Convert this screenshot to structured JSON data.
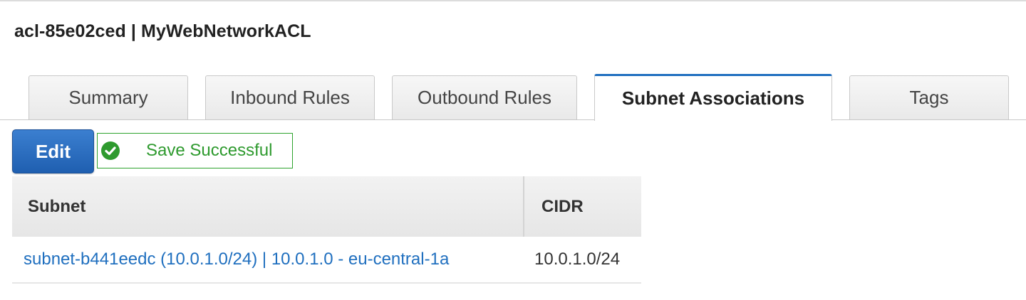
{
  "header": {
    "title": "acl-85e02ced | MyWebNetworkACL"
  },
  "tabs": [
    {
      "label": "Summary",
      "active": false
    },
    {
      "label": "Inbound Rules",
      "active": false
    },
    {
      "label": "Outbound Rules",
      "active": false
    },
    {
      "label": "Subnet Associations",
      "active": true
    },
    {
      "label": "Tags",
      "active": false
    }
  ],
  "toolbar": {
    "edit_label": "Edit",
    "status_text": "Save Successful",
    "status_icon": "check-circle-icon"
  },
  "table": {
    "columns": [
      "Subnet",
      "CIDR"
    ],
    "rows": [
      {
        "subnet": "subnet-b441eedc (10.0.1.0/24) | 10.0.1.0 - eu-central-1a",
        "cidr": "10.0.1.0/24"
      }
    ]
  },
  "colors": {
    "accent": "#1f6fbf",
    "button": "#2a6cc0",
    "success": "#2e9a2e",
    "link": "#1f6fbf"
  }
}
